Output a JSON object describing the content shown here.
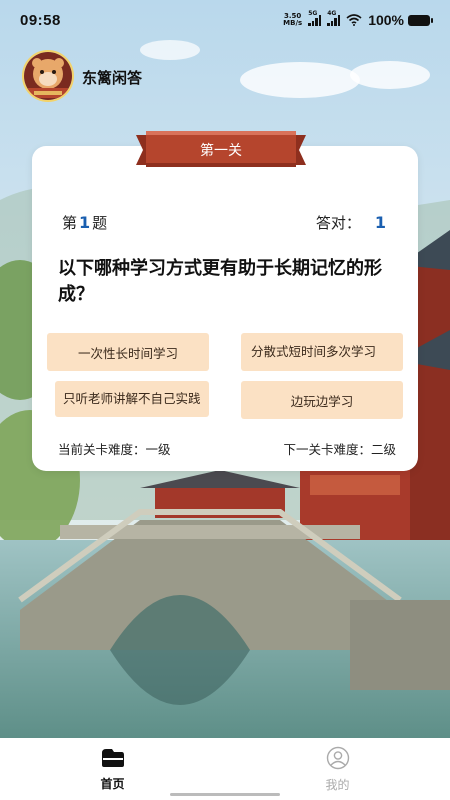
{
  "status_bar": {
    "time": "09:58",
    "net_speed_value": "3.50",
    "net_speed_unit": "MB/s",
    "signal_1_tag": "5G",
    "signal_2_tag": "4G",
    "battery": "100%",
    "icons": [
      "signal-icon",
      "signal-icon",
      "wifi-icon",
      "battery-icon"
    ]
  },
  "app": {
    "title": "东篱闲答",
    "avatar_caption": "东篱闲答"
  },
  "quiz": {
    "level": "第一关",
    "question_prefix": "第",
    "question_number": "1",
    "question_suffix": "题",
    "score_label": "答对：",
    "score_value": "1",
    "question": "以下哪种学习方式更有助于长期记忆的形成？",
    "options": [
      "一次性长时间学习",
      "分散式短时间多次学习",
      "只听老师讲解不自己实践",
      "边玩边学习"
    ],
    "current_difficulty": "当前关卡难度：一级",
    "next_difficulty": "下一关卡难度：二级"
  },
  "nav": {
    "items": [
      {
        "label": "首页",
        "icon": "home-icon",
        "active": true
      },
      {
        "label": "我的",
        "icon": "user-icon",
        "active": false
      }
    ]
  },
  "colors": {
    "banner": "#b5452d",
    "option_bg": "#fbe1c4",
    "accent": "#1a5fb0"
  }
}
